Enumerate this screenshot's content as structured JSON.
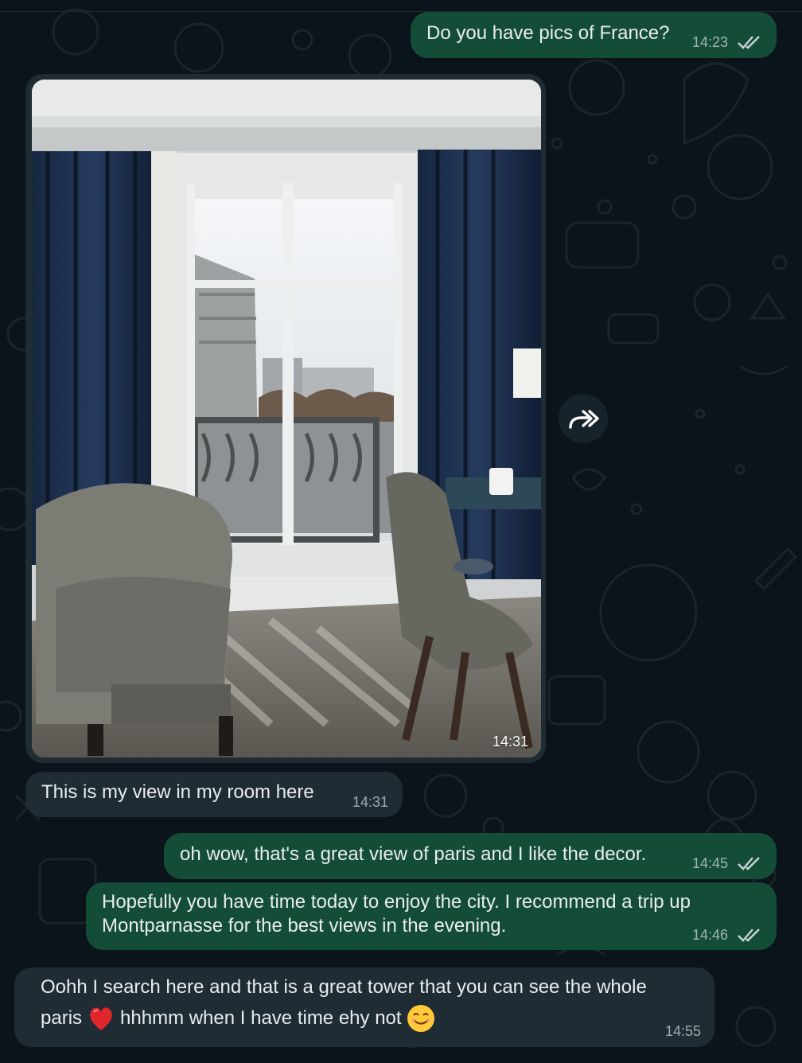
{
  "messages": [
    {
      "direction": "outgoing",
      "text": "Do you have pics of France?",
      "time": "14:23",
      "status": "read"
    },
    {
      "direction": "incoming",
      "type": "image",
      "time": "14:31",
      "image_description": "hotel room with blue curtains, armchair, desk chair and a tall window overlooking Paris"
    },
    {
      "direction": "incoming",
      "text": "This is my view in my room here",
      "time": "14:31"
    },
    {
      "direction": "outgoing",
      "text": "oh wow, that's a great view of paris and I like the decor.",
      "time": "14:45",
      "status": "read"
    },
    {
      "direction": "outgoing",
      "lines": [
        "Hopefully you have time today to enjoy the city. I recommend a trip up",
        "Montparnasse for the best views in the evening."
      ],
      "time": "14:46",
      "status": "read"
    },
    {
      "direction": "incoming",
      "line1": "Oohh I search here and that is a great tower that you can see the whole",
      "line2_a": "paris",
      "line2_b": "hhhmm when I have time ehy not",
      "time": "14:55"
    }
  ],
  "icons": {
    "forward": "forward-icon",
    "read_receipt": "double-check-icon",
    "heart": "red-heart-emoji",
    "smile": "smiling-face-emoji"
  },
  "colors": {
    "background": "#0b141a",
    "outgoing_bubble": "#144d37",
    "incoming_bubble": "#1f2c34",
    "text": "#e9edef"
  }
}
